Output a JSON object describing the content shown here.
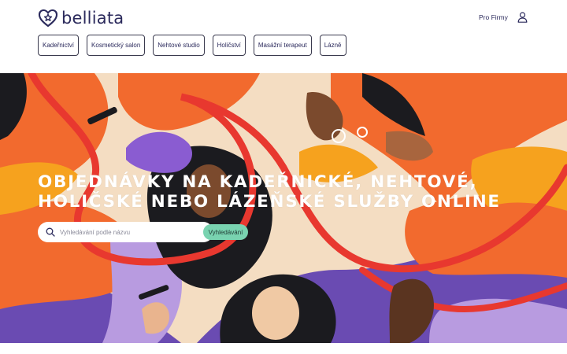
{
  "brand": {
    "name": "belliata",
    "logo_icon": "heart-star-icon",
    "color": "#2b2a5c"
  },
  "header": {
    "pro_firmy": "Pro Firmy",
    "user_icon": "user-icon"
  },
  "categories": [
    {
      "label": "Kadeřnictví"
    },
    {
      "label": "Kosmetický salon"
    },
    {
      "label": "Nehtové studio"
    },
    {
      "label": "Holičství"
    },
    {
      "label": "Masážní terapeut"
    },
    {
      "label": "Lázně"
    }
  ],
  "hero": {
    "headline_line1": "OBJEDNÁVKY NA KADEŘNICKÉ, NEHTOVÉ,",
    "headline_line2": "HOLIČSKÉ NEBO LÁZEŇSKÉ SLUŽBY ONLINE",
    "search_placeholder": "Vyhledávání podle názvu",
    "search_value": "",
    "search_button": "Vyhledávání",
    "accent_color": "#79d3b0",
    "palette": [
      "#e8382f",
      "#f26a2e",
      "#f6a21e",
      "#6a4bb2",
      "#b89be0",
      "#1b1b1f",
      "#f4ddc2"
    ]
  }
}
